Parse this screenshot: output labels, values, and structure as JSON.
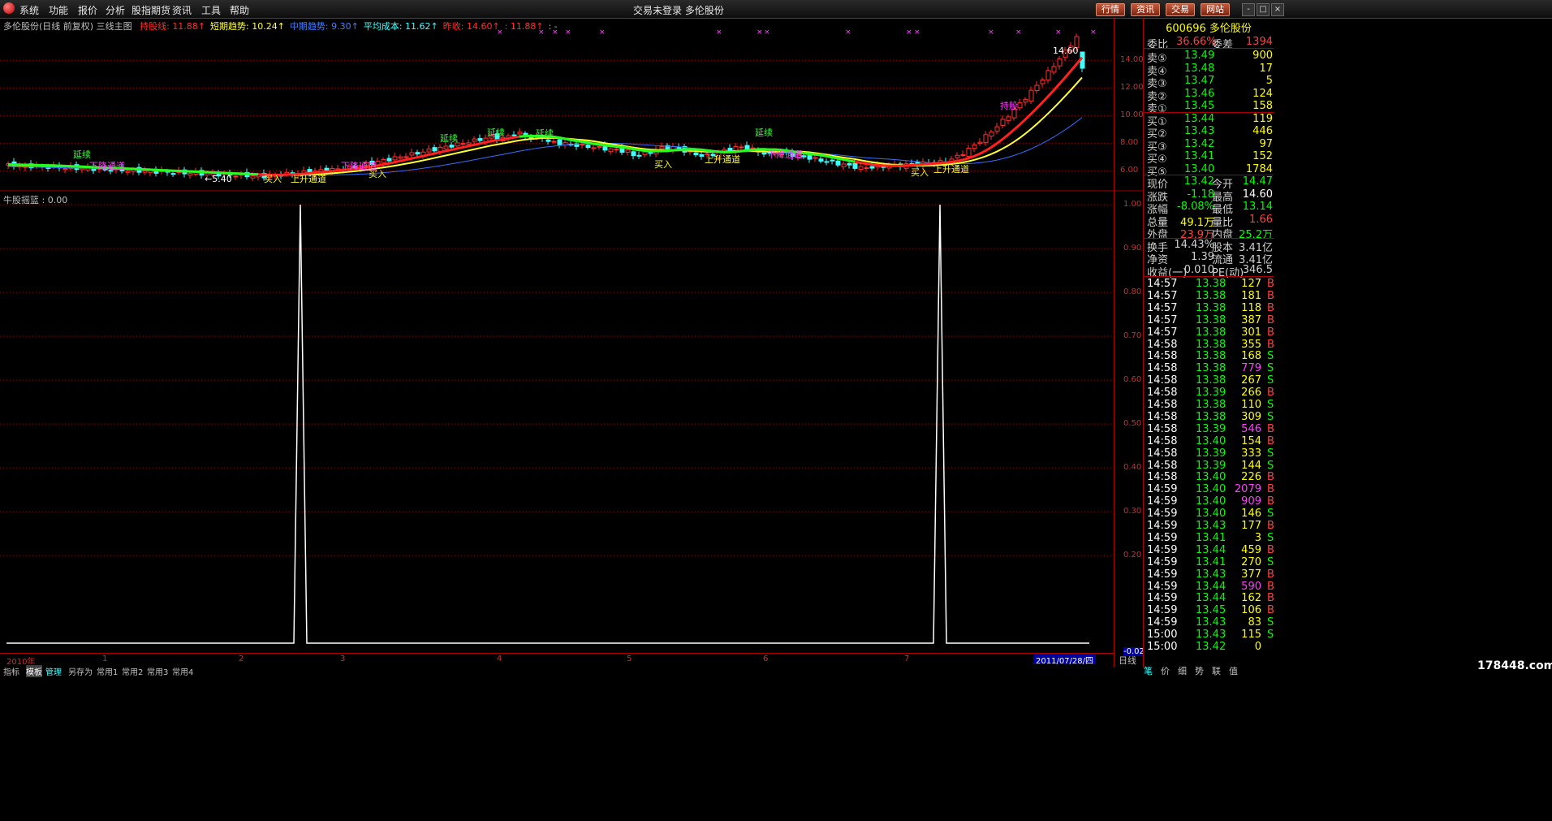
{
  "menu": [
    "系统",
    "功能",
    "报价",
    "分析",
    "股指期货",
    "资讯",
    "工具",
    "帮助"
  ],
  "window_title": "交易未登录  多伦股份",
  "top_buttons": [
    "行情",
    "资讯",
    "交易",
    "网站"
  ],
  "win_buttons": [
    "-",
    "□",
    "×"
  ],
  "info": {
    "name": "多伦股份(日线 前复权) 三线主图",
    "items": [
      {
        "label": "持股线: 11.88↑",
        "color": "#ff3030"
      },
      {
        "label": "短期趋势: 10.24↑",
        "color": "#ffff40"
      },
      {
        "label": "中期趋势: 9.30↑",
        "color": "#4080ff"
      },
      {
        "label": "平均成本: 11.62↑",
        "color": "#40ffff"
      },
      {
        "label": "昨收: 14.60↑",
        "color": "#ff3030"
      },
      {
        "label": ": 11.88↑",
        "color": "#ff3030"
      },
      {
        "label": ": -",
        "color": "#c0c0c0"
      }
    ]
  },
  "main_axis": [
    "14.00",
    "12.00",
    "10.00",
    "8.00",
    "6.00"
  ],
  "main_annotations": {
    "peak": "14.60",
    "low": "←5.40",
    "labels": [
      "上升通道",
      "上升通道",
      "上升通道",
      "买入",
      "买入",
      "买入",
      "买入",
      "延续",
      "延续",
      "延续",
      "延续",
      "延续",
      "持股",
      "下降通道",
      "下降通道",
      "下降通道"
    ]
  },
  "sub": {
    "label": "牛股摇篮 : 0.00",
    "axis": [
      "1.00",
      "0.90",
      "0.80",
      "0.70",
      "0.60",
      "0.50",
      "0.40",
      "0.30",
      "0.20",
      "-0.02"
    ]
  },
  "timeline": [
    "2010年",
    "1",
    "2",
    "3",
    "4",
    "5",
    "6",
    "7"
  ],
  "current_date": "2011/07/28/四",
  "bottom_tabs": [
    "指标",
    "模板",
    "管理",
    "另存为",
    "常用1",
    "常用2",
    "常用3",
    "常用4"
  ],
  "right_panel": {
    "ticker": "600696 多伦股份",
    "weibi": {
      "label": "委比",
      "value": "36.66%",
      "label2": "委差",
      "value2": "1394"
    },
    "sell": [
      {
        "label": "卖⑤",
        "price": "13.49",
        "vol": "900"
      },
      {
        "label": "卖④",
        "price": "13.48",
        "vol": "17"
      },
      {
        "label": "卖③",
        "price": "13.47",
        "vol": "5"
      },
      {
        "label": "卖②",
        "price": "13.46",
        "vol": "124"
      },
      {
        "label": "卖①",
        "price": "13.45",
        "vol": "158"
      }
    ],
    "buy": [
      {
        "label": "买①",
        "price": "13.44",
        "vol": "119"
      },
      {
        "label": "买②",
        "price": "13.43",
        "vol": "446"
      },
      {
        "label": "买③",
        "price": "13.42",
        "vol": "97"
      },
      {
        "label": "买④",
        "price": "13.41",
        "vol": "152"
      },
      {
        "label": "买⑤",
        "price": "13.40",
        "vol": "1784"
      }
    ],
    "stats": [
      {
        "l1": "现价",
        "v1": "13.42",
        "c1": "#00ff00",
        "l2": "今开",
        "v2": "14.47",
        "c2": "#00ff00"
      },
      {
        "l1": "涨跌",
        "v1": "-1.18",
        "c1": "#00ff00",
        "l2": "最高",
        "v2": "14.60",
        "c2": "#ffffff"
      },
      {
        "l1": "涨幅",
        "v1": "-8.08%",
        "c1": "#00ff00",
        "l2": "最低",
        "v2": "13.14",
        "c2": "#00ff00"
      },
      {
        "l1": "总量",
        "v1": "49.1万",
        "c1": "#ffff00",
        "l2": "量比",
        "v2": "1.66",
        "c2": "#ff4040"
      },
      {
        "l1": "外盘",
        "v1": "23.9万",
        "c1": "#ff4040",
        "l2": "内盘",
        "v2": "25.2万",
        "c2": "#00ff00"
      }
    ],
    "stats2": [
      {
        "l1": "换手",
        "v1": "14.43%",
        "l2": "股本",
        "v2": "3.41亿"
      },
      {
        "l1": "净资",
        "v1": "1.39",
        "l2": "流通",
        "v2": "3.41亿"
      },
      {
        "l1": "收益(一)",
        "v1": "0.010",
        "l2": "PE(动)",
        "v2": "346.5"
      }
    ],
    "ticks": [
      {
        "t": "14:57",
        "p": "13.38",
        "v": "127",
        "s": "B",
        "pc": "#00ff00",
        "vc": "#ffff00"
      },
      {
        "t": "14:57",
        "p": "13.38",
        "v": "181",
        "s": "B",
        "pc": "#00ff00",
        "vc": "#ffff00"
      },
      {
        "t": "14:57",
        "p": "13.38",
        "v": "118",
        "s": "B",
        "pc": "#00ff00",
        "vc": "#ffff00"
      },
      {
        "t": "14:57",
        "p": "13.38",
        "v": "387",
        "s": "B",
        "pc": "#00ff00",
        "vc": "#ffff00"
      },
      {
        "t": "14:57",
        "p": "13.38",
        "v": "301",
        "s": "B",
        "pc": "#00ff00",
        "vc": "#ffff00"
      },
      {
        "t": "14:58",
        "p": "13.38",
        "v": "355",
        "s": "B",
        "pc": "#00ff00",
        "vc": "#ffff00"
      },
      {
        "t": "14:58",
        "p": "13.38",
        "v": "168",
        "s": "S",
        "pc": "#00ff00",
        "vc": "#ffff00"
      },
      {
        "t": "14:58",
        "p": "13.38",
        "v": "779",
        "s": "S",
        "pc": "#00ff00",
        "vc": "#ff40ff"
      },
      {
        "t": "14:58",
        "p": "13.38",
        "v": "267",
        "s": "S",
        "pc": "#00ff00",
        "vc": "#ffff00"
      },
      {
        "t": "14:58",
        "p": "13.39",
        "v": "266",
        "s": "B",
        "pc": "#00ff00",
        "vc": "#ffff00"
      },
      {
        "t": "14:58",
        "p": "13.38",
        "v": "110",
        "s": "S",
        "pc": "#00ff00",
        "vc": "#ffff00"
      },
      {
        "t": "14:58",
        "p": "13.38",
        "v": "309",
        "s": "S",
        "pc": "#00ff00",
        "vc": "#ffff00"
      },
      {
        "t": "14:58",
        "p": "13.39",
        "v": "546",
        "s": "B",
        "pc": "#00ff00",
        "vc": "#ff40ff"
      },
      {
        "t": "14:58",
        "p": "13.40",
        "v": "154",
        "s": "B",
        "pc": "#00ff00",
        "vc": "#ffff00"
      },
      {
        "t": "14:58",
        "p": "13.39",
        "v": "333",
        "s": "S",
        "pc": "#00ff00",
        "vc": "#ffff00"
      },
      {
        "t": "14:58",
        "p": "13.39",
        "v": "144",
        "s": "S",
        "pc": "#00ff00",
        "vc": "#ffff00"
      },
      {
        "t": "14:58",
        "p": "13.40",
        "v": "226",
        "s": "B",
        "pc": "#00ff00",
        "vc": "#ffff00"
      },
      {
        "t": "14:59",
        "p": "13.40",
        "v": "2079",
        "s": "B",
        "pc": "#00ff00",
        "vc": "#ff40ff"
      },
      {
        "t": "14:59",
        "p": "13.40",
        "v": "909",
        "s": "B",
        "pc": "#00ff00",
        "vc": "#ff40ff"
      },
      {
        "t": "14:59",
        "p": "13.40",
        "v": "146",
        "s": "S",
        "pc": "#00ff00",
        "vc": "#ffff00"
      },
      {
        "t": "14:59",
        "p": "13.43",
        "v": "177",
        "s": "B",
        "pc": "#00ff00",
        "vc": "#ffff00"
      },
      {
        "t": "14:59",
        "p": "13.41",
        "v": "3",
        "s": "S",
        "pc": "#00ff00",
        "vc": "#ffff00"
      },
      {
        "t": "14:59",
        "p": "13.44",
        "v": "459",
        "s": "B",
        "pc": "#00ff00",
        "vc": "#ffff00"
      },
      {
        "t": "14:59",
        "p": "13.41",
        "v": "270",
        "s": "S",
        "pc": "#00ff00",
        "vc": "#ffff00"
      },
      {
        "t": "14:59",
        "p": "13.43",
        "v": "377",
        "s": "B",
        "pc": "#00ff00",
        "vc": "#ffff00"
      },
      {
        "t": "14:59",
        "p": "13.44",
        "v": "590",
        "s": "B",
        "pc": "#00ff00",
        "vc": "#ff40ff"
      },
      {
        "t": "14:59",
        "p": "13.44",
        "v": "162",
        "s": "B",
        "pc": "#00ff00",
        "vc": "#ffff00"
      },
      {
        "t": "14:59",
        "p": "13.45",
        "v": "106",
        "s": "B",
        "pc": "#00ff00",
        "vc": "#ffff00"
      },
      {
        "t": "14:59",
        "p": "13.43",
        "v": "83",
        "s": "S",
        "pc": "#00ff00",
        "vc": "#ffff00"
      },
      {
        "t": "15:00",
        "p": "13.43",
        "v": "115",
        "s": "S",
        "pc": "#00ff00",
        "vc": "#ffff00"
      },
      {
        "t": "15:00",
        "p": "13.42",
        "v": "0",
        "s": "",
        "pc": "#00ff00",
        "vc": "#ffff00"
      }
    ]
  },
  "status_right": "日线",
  "panel_bottom_tabs": [
    "笔",
    "价",
    "细",
    "势",
    "联",
    "值"
  ],
  "watermark": "178448.com",
  "colors": {
    "up": "#ff3030",
    "down": "#40ffff",
    "grid": "#a00000",
    "hold": "#ff2020",
    "short": "#ffff30",
    "mid": "#3070ff",
    "green": "#20ff20"
  }
}
